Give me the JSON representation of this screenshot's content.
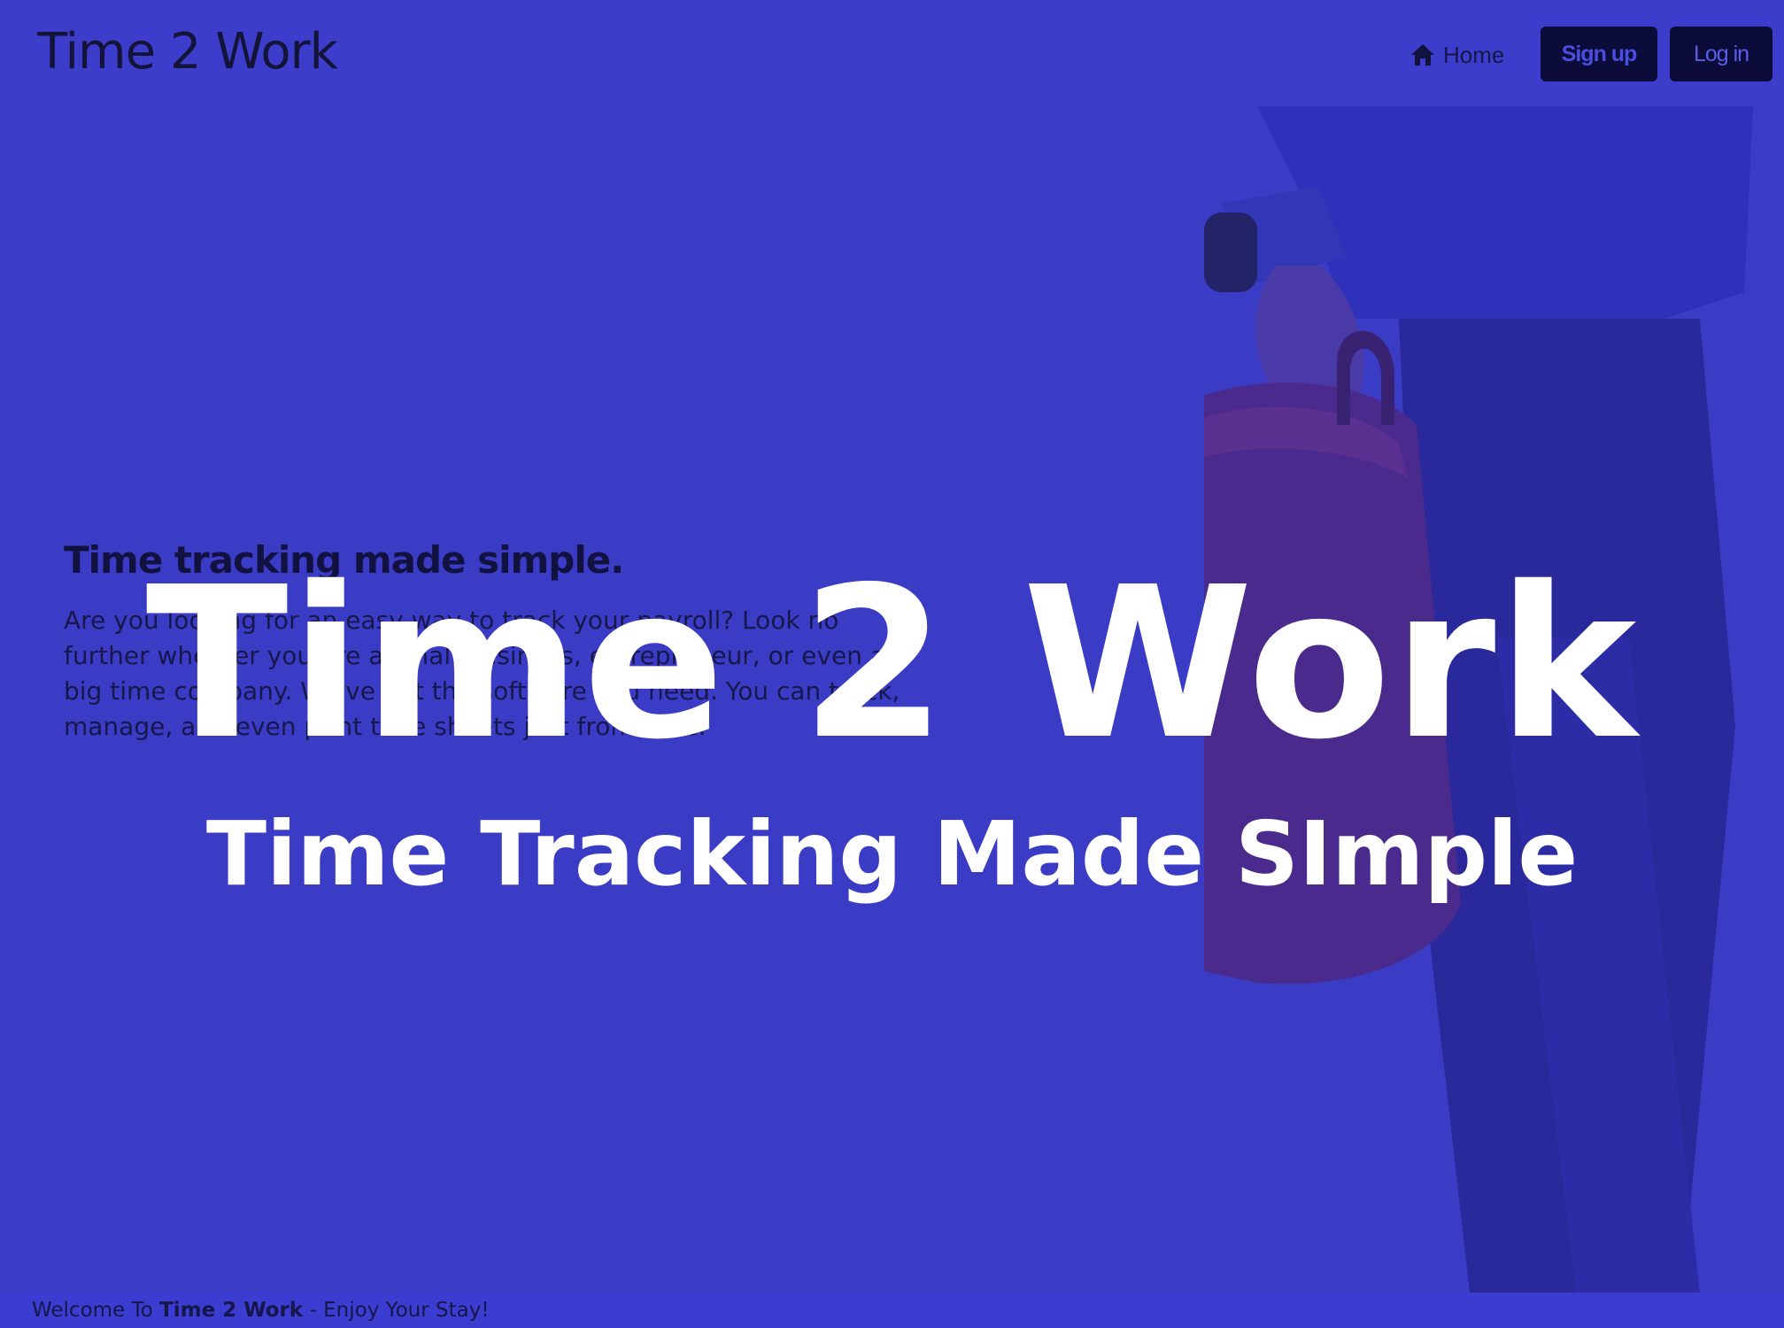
{
  "navbar": {
    "brand": "Time 2 Work",
    "home_label": "Home",
    "signup_label": "Sign up",
    "login_label": "Log in"
  },
  "hero": {
    "heading": "Time tracking made simple.",
    "paragraph": "Are you looking for an easy way to track your payroll? Look no further whether you are a small business, entrepreneur, or even a big time company. We've got the software you need. You can track, manage, and even print time sheets just from here.",
    "overlay_title": "Time 2 Work",
    "overlay_subtitle": "Time Tracking Made SImple"
  },
  "footer": {
    "prefix": "Welcome To ",
    "brand": "Time 2 Work",
    "suffix": " - Enjoy Your Stay!"
  },
  "colors": {
    "brand_blue": "#3b3cc6",
    "button_dark": "#0c0c3a",
    "overlay_text": "#ffffff"
  }
}
